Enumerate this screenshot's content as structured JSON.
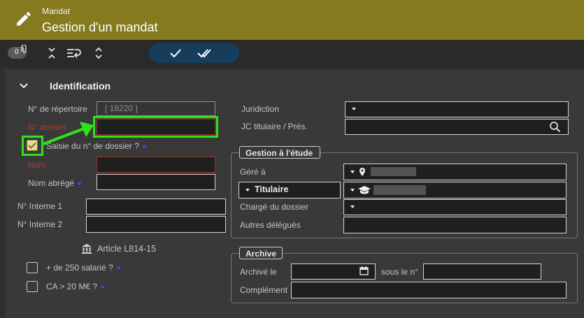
{
  "header": {
    "module": "Mandat",
    "title": "Gestion d'un mandat",
    "edit_icon": "pencil-icon"
  },
  "toolbar": {
    "attachments_count": "0",
    "icons": [
      "collapse-icon",
      "redo-list-icon",
      "expand-icon",
      "check-icon",
      "double-check-icon"
    ]
  },
  "identification": {
    "title": "Identification",
    "repertoire_label": "N° de répertoire",
    "repertoire_value": "[ 18220 ]",
    "dossier_label": "N° dossier",
    "saisie_label": "Saisie du n° de dossier ?",
    "nom_label": "Nom",
    "nom_abrege_label": "Nom abrégé",
    "interne1_label": "N° Interne 1",
    "interne2_label": "N° Interne 2",
    "article_label": "Article L814-15",
    "salaries_label": "+ de 250 salarié ?",
    "ca_label": "CA > 20 M€ ?",
    "juridiction_label": "Juridiction",
    "jc_label": "JC titulaire / Prés."
  },
  "gestion": {
    "legend": "Gestion à l'étude",
    "gere_label": "Géré à",
    "titulaire_label": "Titulaire",
    "charge_label": "Chargé du dossier",
    "autres_label": "Autres délégués"
  },
  "archive": {
    "legend": "Archive",
    "archive_le_label": "Archivé le",
    "sous_le_label": "sous le n°",
    "complement_label": "Complément"
  },
  "colors": {
    "header_bg": "#857a1e",
    "highlight_green": "#2fe21b",
    "required_red": "#b13a33",
    "validate_btn_bg": "#163e5c"
  }
}
